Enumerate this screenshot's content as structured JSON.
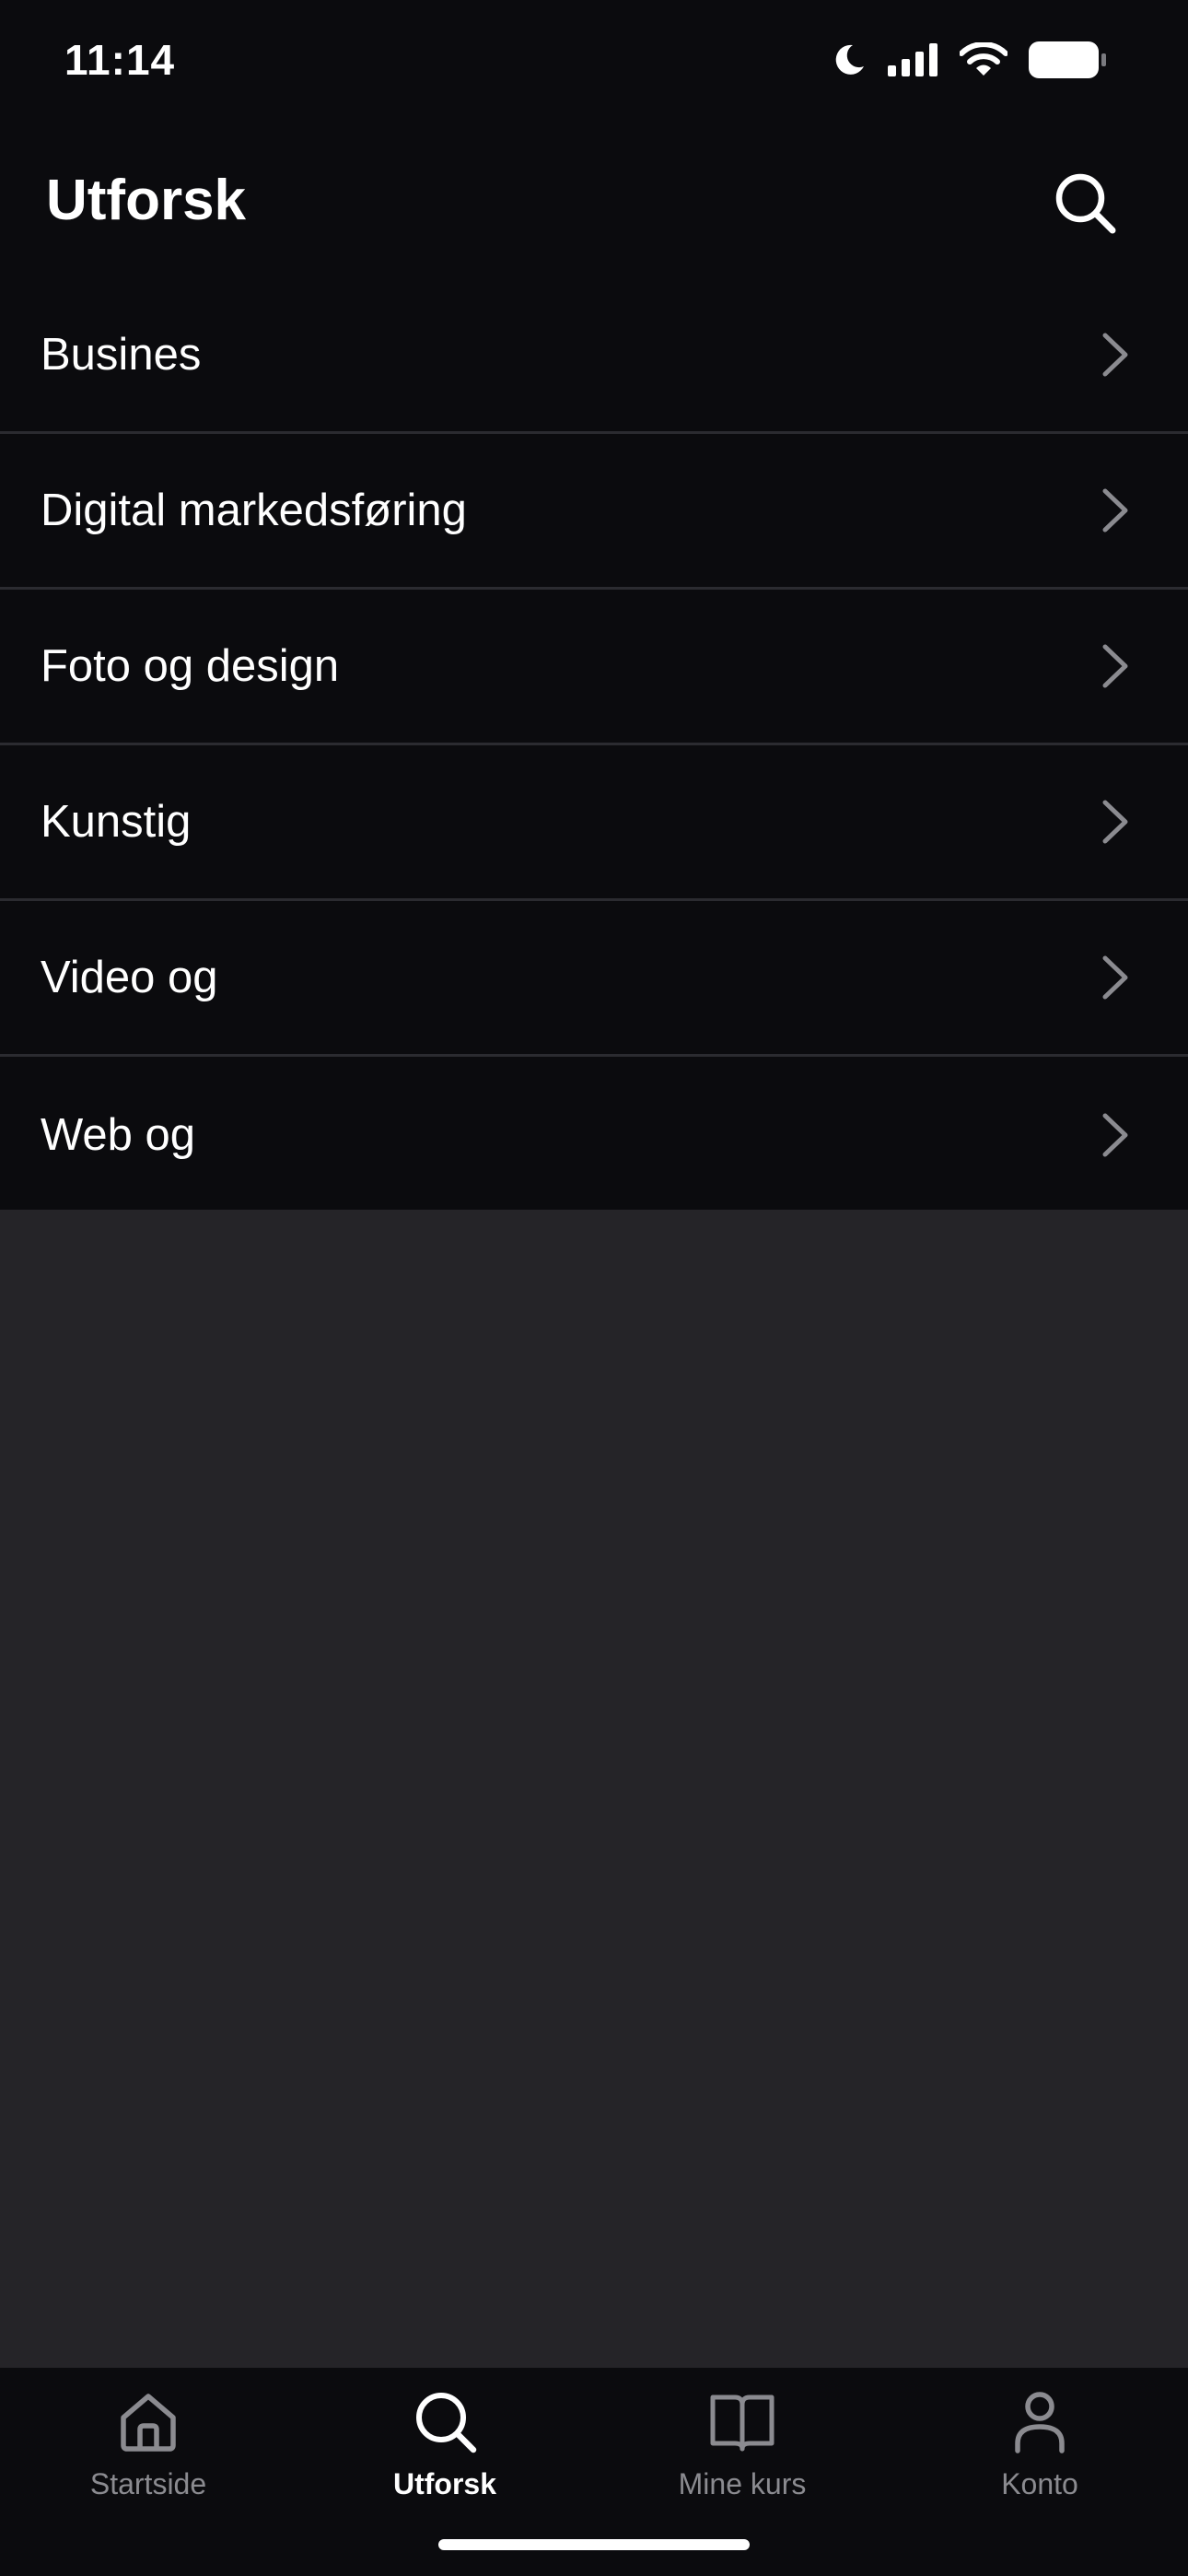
{
  "status_bar": {
    "time": "11:14",
    "icons": [
      "moon-icon",
      "cellular-signal-icon",
      "wifi-icon",
      "battery-icon"
    ]
  },
  "header": {
    "title": "Utforsk",
    "search_icon": "search-icon"
  },
  "categories": [
    {
      "label": "Busines"
    },
    {
      "label": "Digital markedsføring"
    },
    {
      "label": "Foto og design"
    },
    {
      "label": "Kunstig"
    },
    {
      "label": "Video og"
    },
    {
      "label": "Web og"
    }
  ],
  "tab_bar": {
    "tabs": [
      {
        "label": "Startside",
        "icon": "home-icon",
        "active": false
      },
      {
        "label": "Utforsk",
        "icon": "search-icon",
        "active": true
      },
      {
        "label": "Mine kurs",
        "icon": "book-icon",
        "active": false
      },
      {
        "label": "Konto",
        "icon": "person-icon",
        "active": false
      }
    ]
  },
  "colors": {
    "background_top": "#0b0b0e",
    "background_empty": "#252428",
    "divider": "#2b2b30",
    "chevron": "#8b8b90",
    "tab_inactive": "#8b8b90",
    "tab_active": "#ffffff"
  }
}
